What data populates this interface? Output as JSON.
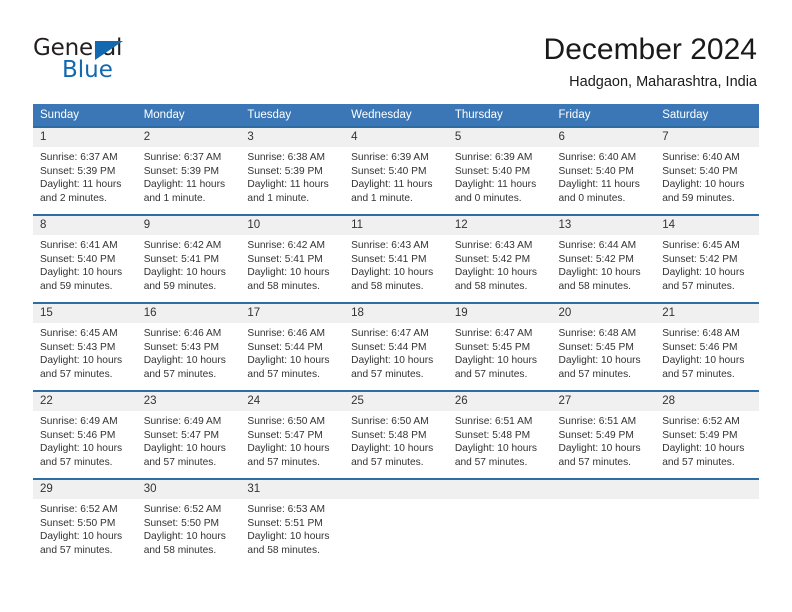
{
  "logo": {
    "word_top": "General",
    "word_bottom": "Blue",
    "triangle_color": "#1269b0"
  },
  "header": {
    "title": "December 2024",
    "subtitle": "Hadgaon, Maharashtra, India"
  },
  "theme": {
    "header_bg": "#3b77b6",
    "row_divider": "#2e6da4",
    "daynum_bg": "#f0f0f0",
    "text": "#333333"
  },
  "calendar": {
    "weekdays": [
      "Sunday",
      "Monday",
      "Tuesday",
      "Wednesday",
      "Thursday",
      "Friday",
      "Saturday"
    ],
    "weeks": [
      [
        {
          "day": "1",
          "sunrise": "Sunrise: 6:37 AM",
          "sunset": "Sunset: 5:39 PM",
          "daylight": "Daylight: 11 hours and 2 minutes."
        },
        {
          "day": "2",
          "sunrise": "Sunrise: 6:37 AM",
          "sunset": "Sunset: 5:39 PM",
          "daylight": "Daylight: 11 hours and 1 minute."
        },
        {
          "day": "3",
          "sunrise": "Sunrise: 6:38 AM",
          "sunset": "Sunset: 5:39 PM",
          "daylight": "Daylight: 11 hours and 1 minute."
        },
        {
          "day": "4",
          "sunrise": "Sunrise: 6:39 AM",
          "sunset": "Sunset: 5:40 PM",
          "daylight": "Daylight: 11 hours and 1 minute."
        },
        {
          "day": "5",
          "sunrise": "Sunrise: 6:39 AM",
          "sunset": "Sunset: 5:40 PM",
          "daylight": "Daylight: 11 hours and 0 minutes."
        },
        {
          "day": "6",
          "sunrise": "Sunrise: 6:40 AM",
          "sunset": "Sunset: 5:40 PM",
          "daylight": "Daylight: 11 hours and 0 minutes."
        },
        {
          "day": "7",
          "sunrise": "Sunrise: 6:40 AM",
          "sunset": "Sunset: 5:40 PM",
          "daylight": "Daylight: 10 hours and 59 minutes."
        }
      ],
      [
        {
          "day": "8",
          "sunrise": "Sunrise: 6:41 AM",
          "sunset": "Sunset: 5:40 PM",
          "daylight": "Daylight: 10 hours and 59 minutes."
        },
        {
          "day": "9",
          "sunrise": "Sunrise: 6:42 AM",
          "sunset": "Sunset: 5:41 PM",
          "daylight": "Daylight: 10 hours and 59 minutes."
        },
        {
          "day": "10",
          "sunrise": "Sunrise: 6:42 AM",
          "sunset": "Sunset: 5:41 PM",
          "daylight": "Daylight: 10 hours and 58 minutes."
        },
        {
          "day": "11",
          "sunrise": "Sunrise: 6:43 AM",
          "sunset": "Sunset: 5:41 PM",
          "daylight": "Daylight: 10 hours and 58 minutes."
        },
        {
          "day": "12",
          "sunrise": "Sunrise: 6:43 AM",
          "sunset": "Sunset: 5:42 PM",
          "daylight": "Daylight: 10 hours and 58 minutes."
        },
        {
          "day": "13",
          "sunrise": "Sunrise: 6:44 AM",
          "sunset": "Sunset: 5:42 PM",
          "daylight": "Daylight: 10 hours and 58 minutes."
        },
        {
          "day": "14",
          "sunrise": "Sunrise: 6:45 AM",
          "sunset": "Sunset: 5:42 PM",
          "daylight": "Daylight: 10 hours and 57 minutes."
        }
      ],
      [
        {
          "day": "15",
          "sunrise": "Sunrise: 6:45 AM",
          "sunset": "Sunset: 5:43 PM",
          "daylight": "Daylight: 10 hours and 57 minutes."
        },
        {
          "day": "16",
          "sunrise": "Sunrise: 6:46 AM",
          "sunset": "Sunset: 5:43 PM",
          "daylight": "Daylight: 10 hours and 57 minutes."
        },
        {
          "day": "17",
          "sunrise": "Sunrise: 6:46 AM",
          "sunset": "Sunset: 5:44 PM",
          "daylight": "Daylight: 10 hours and 57 minutes."
        },
        {
          "day": "18",
          "sunrise": "Sunrise: 6:47 AM",
          "sunset": "Sunset: 5:44 PM",
          "daylight": "Daylight: 10 hours and 57 minutes."
        },
        {
          "day": "19",
          "sunrise": "Sunrise: 6:47 AM",
          "sunset": "Sunset: 5:45 PM",
          "daylight": "Daylight: 10 hours and 57 minutes."
        },
        {
          "day": "20",
          "sunrise": "Sunrise: 6:48 AM",
          "sunset": "Sunset: 5:45 PM",
          "daylight": "Daylight: 10 hours and 57 minutes."
        },
        {
          "day": "21",
          "sunrise": "Sunrise: 6:48 AM",
          "sunset": "Sunset: 5:46 PM",
          "daylight": "Daylight: 10 hours and 57 minutes."
        }
      ],
      [
        {
          "day": "22",
          "sunrise": "Sunrise: 6:49 AM",
          "sunset": "Sunset: 5:46 PM",
          "daylight": "Daylight: 10 hours and 57 minutes."
        },
        {
          "day": "23",
          "sunrise": "Sunrise: 6:49 AM",
          "sunset": "Sunset: 5:47 PM",
          "daylight": "Daylight: 10 hours and 57 minutes."
        },
        {
          "day": "24",
          "sunrise": "Sunrise: 6:50 AM",
          "sunset": "Sunset: 5:47 PM",
          "daylight": "Daylight: 10 hours and 57 minutes."
        },
        {
          "day": "25",
          "sunrise": "Sunrise: 6:50 AM",
          "sunset": "Sunset: 5:48 PM",
          "daylight": "Daylight: 10 hours and 57 minutes."
        },
        {
          "day": "26",
          "sunrise": "Sunrise: 6:51 AM",
          "sunset": "Sunset: 5:48 PM",
          "daylight": "Daylight: 10 hours and 57 minutes."
        },
        {
          "day": "27",
          "sunrise": "Sunrise: 6:51 AM",
          "sunset": "Sunset: 5:49 PM",
          "daylight": "Daylight: 10 hours and 57 minutes."
        },
        {
          "day": "28",
          "sunrise": "Sunrise: 6:52 AM",
          "sunset": "Sunset: 5:49 PM",
          "daylight": "Daylight: 10 hours and 57 minutes."
        }
      ],
      [
        {
          "day": "29",
          "sunrise": "Sunrise: 6:52 AM",
          "sunset": "Sunset: 5:50 PM",
          "daylight": "Daylight: 10 hours and 57 minutes."
        },
        {
          "day": "30",
          "sunrise": "Sunrise: 6:52 AM",
          "sunset": "Sunset: 5:50 PM",
          "daylight": "Daylight: 10 hours and 58 minutes."
        },
        {
          "day": "31",
          "sunrise": "Sunrise: 6:53 AM",
          "sunset": "Sunset: 5:51 PM",
          "daylight": "Daylight: 10 hours and 58 minutes."
        },
        {
          "day": "",
          "sunrise": "",
          "sunset": "",
          "daylight": ""
        },
        {
          "day": "",
          "sunrise": "",
          "sunset": "",
          "daylight": ""
        },
        {
          "day": "",
          "sunrise": "",
          "sunset": "",
          "daylight": ""
        },
        {
          "day": "",
          "sunrise": "",
          "sunset": "",
          "daylight": ""
        }
      ]
    ]
  }
}
